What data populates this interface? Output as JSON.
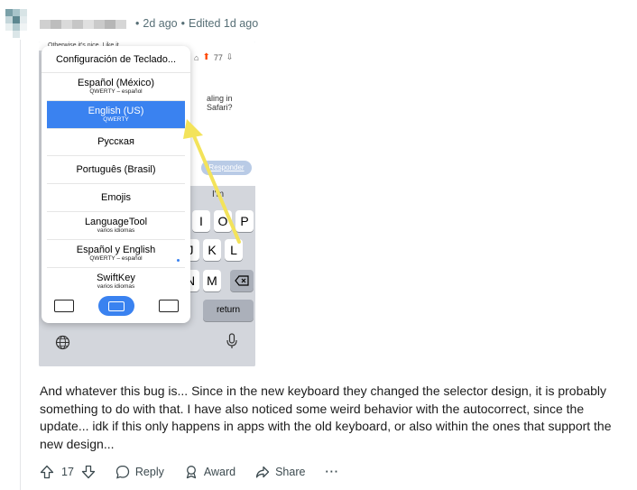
{
  "comment": {
    "meta_sep": "•",
    "posted": "2d ago",
    "edited": "Edited 1d ago",
    "body": "And whatever this bug is... Since in the new keyboard they changed the selector design, it is probably something to do with that. I have also noticed some weird behavior with the autocorrect, since the update... idk if this only happens in apps with the old keyboard, or also within the ones that support the new design...",
    "score": "17",
    "reply_label": "Reply",
    "award_label": "Award",
    "share_label": "Share",
    "more_label": "···"
  },
  "screenshot": {
    "top_snippet": "Otherwise it's nice. Like it",
    "vote_count": "77",
    "bg_text": "aling in Safari?",
    "reply_button": "Responder",
    "kb_hint": "I'm",
    "keys_row1": [
      "I",
      "O",
      "P"
    ],
    "keys_row2": [
      "J",
      "K",
      "L"
    ],
    "keys_row3": [
      "N",
      "M"
    ],
    "return_label": "return",
    "popup": {
      "title": "Configuración de Teclado...",
      "items": [
        {
          "label": "Español (México)",
          "sub": "QWERTY – español"
        },
        {
          "label": "English (US)",
          "sub": "QWERTY"
        },
        {
          "label": "Русская",
          "sub": ""
        },
        {
          "label": "Português (Brasil)",
          "sub": ""
        },
        {
          "label": "Emojis",
          "sub": ""
        },
        {
          "label": "LanguageTool",
          "sub": "varios idiomas"
        },
        {
          "label": "Español y English",
          "sub": "QWERTY – español"
        },
        {
          "label": "SwiftKey",
          "sub": "varios idiomas"
        }
      ]
    }
  },
  "colors": {
    "accent": "#3a82f0",
    "arrow": "#f3e35a",
    "upvote": "#ff4500"
  }
}
